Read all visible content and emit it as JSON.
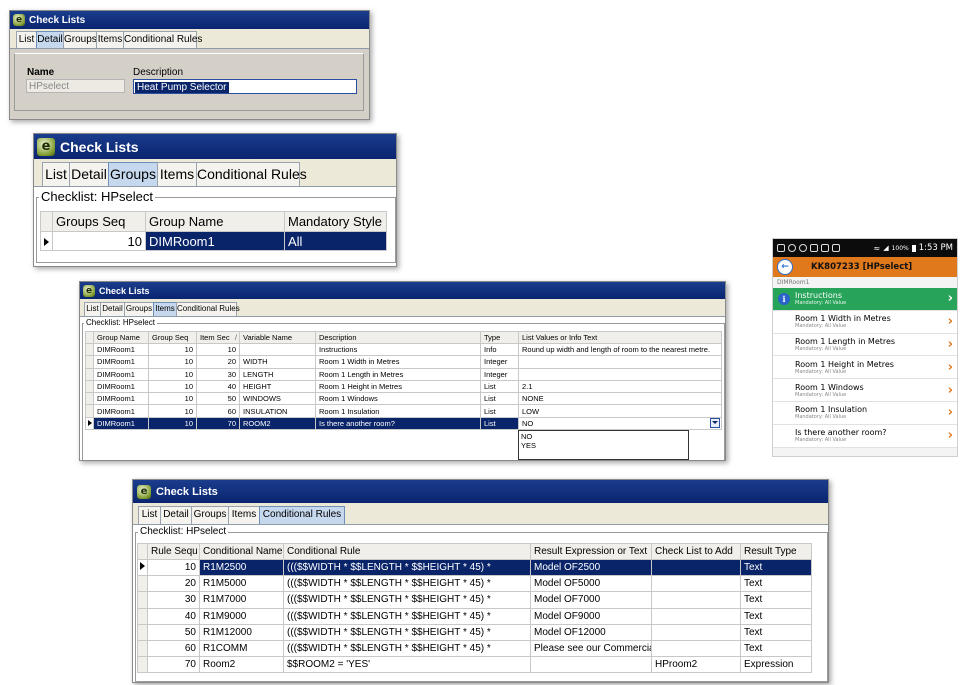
{
  "app": {
    "window_title": "Check Lists"
  },
  "tabs": [
    "List",
    "Detail",
    "Groups",
    "Items",
    "Conditional Rules"
  ],
  "detail": {
    "name_label": "Name",
    "description_label": "Description",
    "name_value": "HPselect",
    "description_value": "Heat Pump Selector"
  },
  "groups": {
    "legend": "Checklist: HPselect",
    "columns": [
      "Groups Seq",
      "Group Name",
      "Mandatory Style"
    ],
    "rows": [
      [
        "10",
        "DIMRoom1",
        "All"
      ]
    ]
  },
  "items": {
    "legend": "Checklist: HPselect",
    "columns": [
      "Group Name",
      "Group Seq",
      "Item Sec",
      "Variable Name",
      "Description",
      "Type",
      "List Values or Info Text"
    ],
    "sort_arrow": "/",
    "rows": [
      [
        "DIMRoom1",
        "10",
        "10",
        "",
        "Instructions",
        "Info",
        "Round up width and length of room to the nearest metre."
      ],
      [
        "DIMRoom1",
        "10",
        "20",
        "WIDTH",
        "Room 1 Width in Metres",
        "Integer",
        ""
      ],
      [
        "DIMRoom1",
        "10",
        "30",
        "LENGTH",
        "Room 1 Length in Metres",
        "Integer",
        ""
      ],
      [
        "DIMRoom1",
        "10",
        "40",
        "HEIGHT",
        "Room 1 Height in Metres",
        "List",
        "2.1"
      ],
      [
        "DIMRoom1",
        "10",
        "50",
        "WINDOWS",
        "Room 1 Windows",
        "List",
        "NONE"
      ],
      [
        "DIMRoom1",
        "10",
        "60",
        "INSULATION",
        "Room 1 Insulation",
        "List",
        "LOW"
      ],
      [
        "DIMRoom1",
        "10",
        "70",
        "ROOM2",
        "Is there another room?",
        "List",
        "NO"
      ]
    ],
    "dropdown_options": [
      "NO",
      "YES"
    ]
  },
  "rules": {
    "legend": "Checklist: HPselect",
    "columns": [
      "Rule Sequ",
      "Conditional Name",
      "Conditional Rule",
      "Result Expression or Text",
      "Check List to Add",
      "Result Type"
    ],
    "rows": [
      [
        "10",
        "R1M2500",
        "((($$WIDTH * $$LENGTH * $$HEIGHT * 45) *",
        "Model OF2500",
        "",
        "Text"
      ],
      [
        "20",
        "R1M5000",
        "((($$WIDTH * $$LENGTH * $$HEIGHT * 45) *",
        "Model OF5000",
        "",
        "Text"
      ],
      [
        "30",
        "R1M7000",
        "((($$WIDTH * $$LENGTH * $$HEIGHT * 45) *",
        "Model OF7000",
        "",
        "Text"
      ],
      [
        "40",
        "R1M9000",
        "((($$WIDTH * $$LENGTH * $$HEIGHT * 45) *",
        "Model OF9000",
        "",
        "Text"
      ],
      [
        "50",
        "R1M12000",
        "((($$WIDTH * $$LENGTH * $$HEIGHT * 45) *",
        "Model OF12000",
        "",
        "Text"
      ],
      [
        "60",
        "R1COMM",
        "((($$WIDTH * $$LENGTH * $$HEIGHT * 45) *",
        "Please see our Commercial",
        "",
        "Text"
      ],
      [
        "70",
        "Room2",
        "$$ROOM2 = 'YES'",
        "",
        "HProom2",
        "Expression"
      ]
    ]
  },
  "phone": {
    "status_time": "1:53 PM",
    "status_battery": "100%",
    "title": "KK807233 [HPselect]",
    "breadcrumb": "DIMRoom1",
    "items": [
      {
        "title": "Instructions",
        "subtitle": "Mandatory: All Value"
      },
      {
        "title": "Room 1 Width in Metres",
        "subtitle": "Mandatory: All Value"
      },
      {
        "title": "Room 1 Length in Metres",
        "subtitle": "Mandatory: All Value"
      },
      {
        "title": "Room 1 Height in Metres",
        "subtitle": "Mandatory: All Value"
      },
      {
        "title": "Room 1 Windows",
        "subtitle": "Mandatory: All Value"
      },
      {
        "title": "Room 1 Insulation",
        "subtitle": "Mandatory: All Value"
      },
      {
        "title": "Is there another room?",
        "subtitle": "Mandatory: All Value"
      }
    ],
    "accent_color": "#e0781c",
    "active_color": "#27a35a"
  }
}
